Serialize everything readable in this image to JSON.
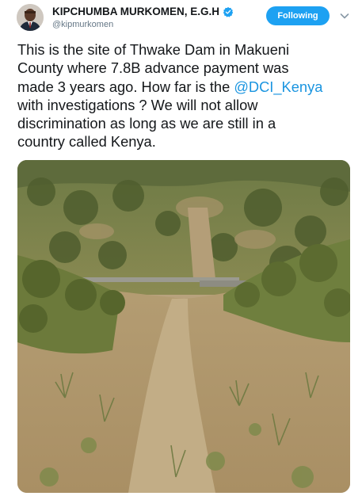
{
  "tweet": {
    "author": {
      "display_name": "KIPCHUMBA MURKOMEN, E.G.H",
      "handle": "@kipmurkomen",
      "verified": true,
      "avatar_icon": "profile-photo"
    },
    "follow_label": "Following",
    "menu_icon": "chevron-down-icon",
    "text_lines": [
      "This is the site of Thwake Dam in Makueni",
      "County where 7.8B advance payment was",
      "made 3 years ago. How far is the ",
      "with investigations ? We will not allow",
      "discrimination as long as we are still in a",
      "country called Kenya."
    ],
    "mention": "@DCI_Kenya",
    "colors": {
      "accent": "#1da1f2",
      "link": "#1b95e0",
      "verified": "#1da1f2",
      "text": "#14171a",
      "secondary": "#657786"
    }
  }
}
